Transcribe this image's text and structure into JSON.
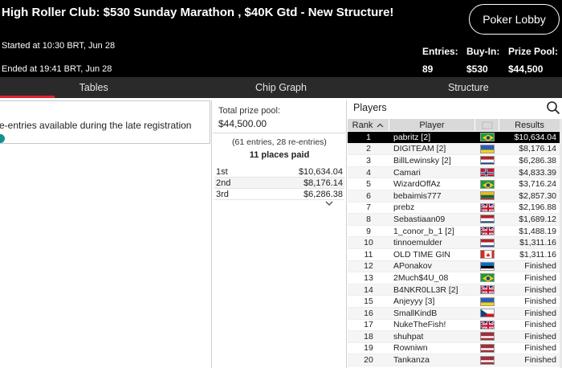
{
  "header": {
    "title": "High Roller Club: $530 Sunday Marathon , $40K Gtd - New Structure!",
    "lobby_button": "Poker Lobby",
    "started": "Started at 10:30 BRT, Jun 28",
    "ended": "Ended at 19:41 BRT, Jun 28",
    "stats": [
      {
        "label": "Entries:",
        "value": "89"
      },
      {
        "label": "Buy-In:",
        "value": "$530"
      },
      {
        "label": "Prize Pool:",
        "value": "$44,500"
      }
    ]
  },
  "tabs": [
    {
      "label": "Tables",
      "active": true
    },
    {
      "label": "Chip Graph",
      "active": false
    },
    {
      "label": "Structure",
      "active": false
    }
  ],
  "left": {
    "text": "e-entries available during the late registration"
  },
  "prize": {
    "label": "Total prize pool:",
    "value": "$44,500.00",
    "entries": "(61 entries, 28 re-entries)",
    "paid": "11 places paid",
    "places": [
      {
        "place": "1st",
        "amount": "$10,634.04"
      },
      {
        "place": "2nd",
        "amount": "$8,176.14"
      },
      {
        "place": "3rd",
        "amount": "$6,286.38"
      }
    ],
    "more_icon": "chevron-down-icon"
  },
  "players": {
    "title": "Players",
    "search_icon": "search-icon",
    "columns": {
      "rank": "Rank",
      "player": "Player",
      "results": "Results"
    },
    "rows": [
      {
        "rank": "1",
        "player": "pabritz [2]",
        "flag": "brazil",
        "result": "$10,634.04",
        "selected": true
      },
      {
        "rank": "2",
        "player": "DIGITEAM [2]",
        "flag": "ukraine",
        "result": "$8,176.14"
      },
      {
        "rank": "3",
        "player": "BillLewinsky [2]",
        "flag": "netherlands",
        "result": "$6,286.38"
      },
      {
        "rank": "4",
        "player": "Camari",
        "flag": "norway",
        "result": "$4,833.39"
      },
      {
        "rank": "5",
        "player": "WizardOffAz",
        "flag": "brazil",
        "result": "$3,716.24"
      },
      {
        "rank": "6",
        "player": "bebaimis777",
        "flag": "lithuania",
        "result": "$2,857.30"
      },
      {
        "rank": "7",
        "player": "prebz",
        "flag": "uk",
        "result": "$2,196.88"
      },
      {
        "rank": "8",
        "player": "Sebastiaan09",
        "flag": "netherlands",
        "result": "$1,689.12"
      },
      {
        "rank": "9",
        "player": "1_conor_b_1 [2]",
        "flag": "uk",
        "result": "$1,488.19"
      },
      {
        "rank": "10",
        "player": "tinnoemulder",
        "flag": "netherlands",
        "result": "$1,311.16"
      },
      {
        "rank": "11",
        "player": "OLD TIME GIN",
        "flag": "canada",
        "result": "$1,311.16"
      },
      {
        "rank": "12",
        "player": "APonakov",
        "flag": "estonia",
        "result": "Finished"
      },
      {
        "rank": "13",
        "player": "2Much$4U_08",
        "flag": "brazil",
        "result": "Finished"
      },
      {
        "rank": "14",
        "player": "B4NKR0LL3R [2]",
        "flag": "uk",
        "result": "Finished"
      },
      {
        "rank": "15",
        "player": "Anjeyyy [3]",
        "flag": "ukraine",
        "result": "Finished"
      },
      {
        "rank": "16",
        "player": "SmallKindB",
        "flag": "czech",
        "result": "Finished"
      },
      {
        "rank": "17",
        "player": "NukeTheFish!",
        "flag": "uk",
        "result": "Finished"
      },
      {
        "rank": "18",
        "player": "shuhpat",
        "flag": "latvia",
        "result": "Finished"
      },
      {
        "rank": "19",
        "player": "Rowniwn",
        "flag": "latvia",
        "result": "Finished"
      },
      {
        "rank": "20",
        "player": "Tankanza",
        "flag": "latvia",
        "result": "Finished"
      }
    ]
  },
  "colors": {
    "header_bg": "#000000",
    "tab_bar": "#2a2a2a",
    "tab_active_accent": "#e0242c",
    "info_dot": "#14908f",
    "selected_row": "#000000"
  }
}
